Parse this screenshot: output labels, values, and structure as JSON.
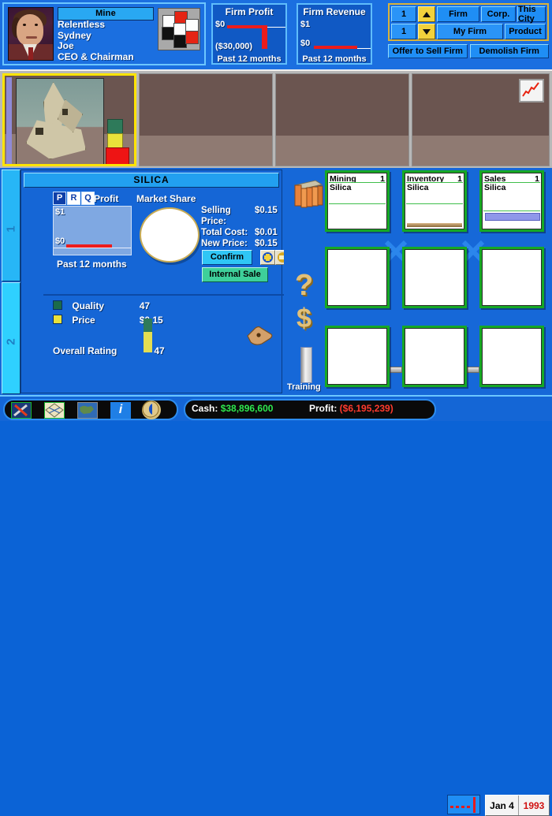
{
  "player": {
    "nameplate": "Mine",
    "lines": [
      "Relentless",
      "Sydney",
      "Joe",
      "CEO & Chairman"
    ],
    "portrait_icon": "executive-portrait",
    "logo_icon": "company-cube-logo"
  },
  "meters": [
    {
      "title": "Firm Profit",
      "top_label": "$0",
      "bottom_label": "($30,000)",
      "footer": "Past 12 months",
      "line_color": "#ec1c1c"
    },
    {
      "title": "Firm Revenue",
      "top_label": "$1",
      "bottom_label": "$0",
      "footer": "Past 12 months",
      "line_color": "#ec1c1c"
    }
  ],
  "controls": {
    "row1": {
      "value": "1",
      "spinner": "up-arrow",
      "buttons": [
        "Firm",
        "Corp.",
        "This City"
      ]
    },
    "row2": {
      "value": "1",
      "spinner": "down-arrow",
      "buttons": [
        "My Firm",
        "Product"
      ]
    },
    "actions": [
      "Offer to Sell Firm",
      "Demolish Firm"
    ]
  },
  "lots": [
    {
      "selected": true,
      "has_building": true,
      "icon": "silica-mineral-photo"
    },
    {
      "selected": false,
      "has_building": false,
      "icon": "empty-lot"
    },
    {
      "selected": false,
      "has_building": false,
      "icon": "empty-lot"
    },
    {
      "selected": false,
      "has_building": false,
      "icon": "empty-lot"
    }
  ],
  "chart_button": {
    "icon": "line-chart-icon"
  },
  "side_tabs": [
    {
      "label": "1",
      "active": false
    },
    {
      "label": "2",
      "active": true
    }
  ],
  "product": {
    "title": "SILICA",
    "prq": [
      {
        "label": "P",
        "active": false
      },
      {
        "label": "R",
        "active": true
      },
      {
        "label": "Q",
        "active": true
      }
    ],
    "profit_label": "Profit",
    "market_share_label": "Market Share",
    "profit_chart": {
      "top": "$1",
      "bottom": "$0",
      "footer": "Past 12 months"
    },
    "stats": [
      {
        "key": "Selling Price:",
        "value": "$0.15"
      },
      {
        "key": "Total Cost:",
        "value": "$0.01"
      },
      {
        "key": "New Price:",
        "value": "$0.15"
      }
    ],
    "confirm_label": "Confirm",
    "plus_icon": "plus-circle-icon",
    "minus_icon": "minus-circle-icon",
    "internal_sale_label": "Internal Sale",
    "ratings": [
      {
        "swatch": "#1b6b4a",
        "label": "Quality",
        "value": "47"
      },
      {
        "swatch": "#e9e23a",
        "label": "Price",
        "value": "$0.15"
      }
    ],
    "overall_label": "Overall Rating",
    "overall_value": "47",
    "cursor_icon": "pointing-hand-cursor"
  },
  "sidebar_icons": {
    "pallet": "crate-stack-icon",
    "question": "question-mark-icon",
    "dollar": "dollar-sign-icon",
    "training_bar": "training-meter",
    "training_label": "Training"
  },
  "cards": [
    {
      "title": "Mining",
      "count": "1",
      "sub": "Silica",
      "filled": true,
      "decoration": "none"
    },
    {
      "title": "Inventory",
      "count": "1",
      "sub": "Silica",
      "filled": true,
      "decoration": "wood-stock"
    },
    {
      "title": "Sales",
      "count": "1",
      "sub": "Silica",
      "filled": true,
      "decoration": "sales-bars"
    },
    {
      "title": "",
      "count": "",
      "sub": "",
      "filled": false,
      "decoration": "none"
    },
    {
      "title": "",
      "count": "",
      "sub": "",
      "filled": false,
      "decoration": "none"
    },
    {
      "title": "",
      "count": "",
      "sub": "",
      "filled": false,
      "decoration": "none"
    },
    {
      "title": "",
      "count": "",
      "sub": "",
      "filled": false,
      "decoration": "none"
    },
    {
      "title": "",
      "count": "",
      "sub": "",
      "filled": false,
      "decoration": "none"
    },
    {
      "title": "",
      "count": "",
      "sub": "",
      "filled": false,
      "decoration": "none"
    }
  ],
  "bottom": {
    "toolbar_icons": [
      "tools-icon",
      "city-grid-icon",
      "world-map-icon",
      "info-icon",
      "back-arrow-icon"
    ],
    "cash_label": "Cash:",
    "cash_value": "$38,896,600",
    "profit_label": "Profit:",
    "profit_value": "($6,195,239)",
    "clock_icon": "speed-clock-icon",
    "date": "Jan 4",
    "year": "1993"
  },
  "colors": {
    "accent_blue": "#1668d8",
    "light_blue": "#2fc6f5",
    "card_green": "#16a825",
    "gold": "#d8b23a",
    "cash_green": "#2ee84f",
    "loss_red": "#ff3a2e"
  }
}
